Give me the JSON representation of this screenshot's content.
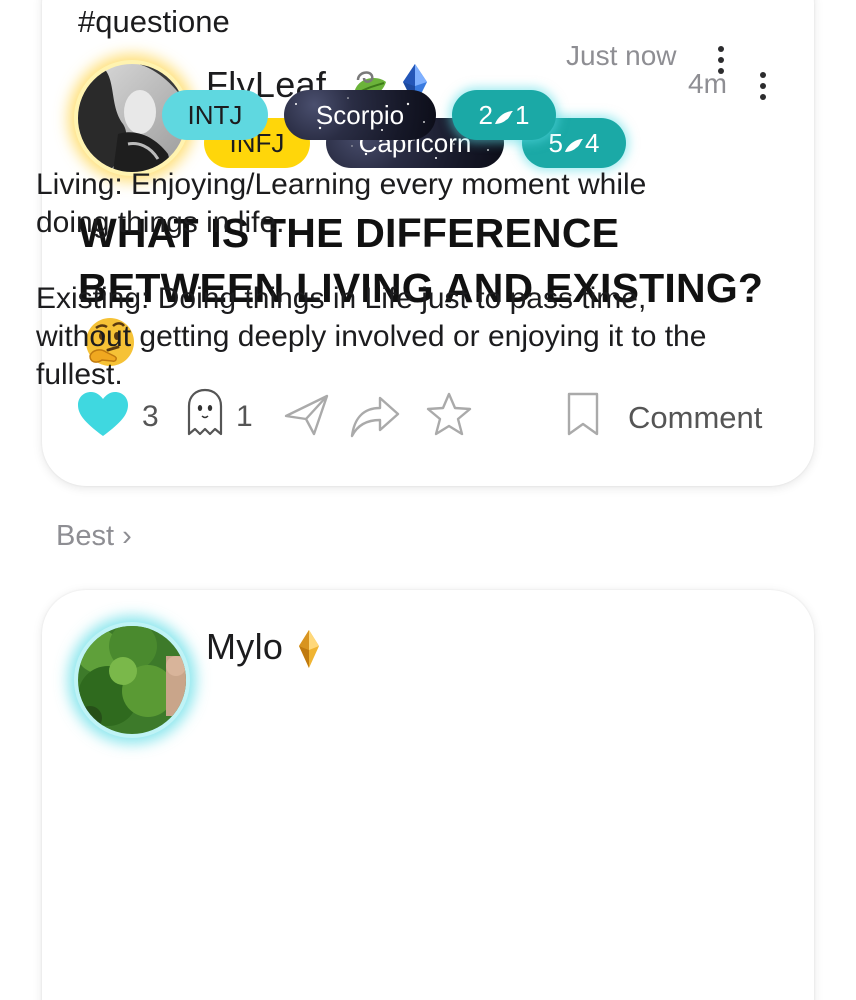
{
  "post": {
    "hashtag": "#questione",
    "author": {
      "name": "FlyLeaf",
      "badges": [
        "leaf-swirl-icon",
        "blue-crystal-icon"
      ],
      "mbti": "INFJ",
      "zodiac": "Capricorn",
      "enneagram_left": "5",
      "enneagram_right": "4"
    },
    "time": "4m",
    "title": "WHAT IS THE DIFFERENCE BETWEEN LIVING AND EXISTING?",
    "title_emoji": "thinking-face-emoji",
    "likes": "3",
    "ghost_count": "1",
    "comment_label": "Comment",
    "like_color": "#3fd8e0"
  },
  "sort": {
    "label": "Best",
    "chevron": "›"
  },
  "reply": {
    "author": {
      "name": "Mylo",
      "badges": [
        "gold-crystal-icon"
      ],
      "mbti": "INTJ",
      "zodiac": "Scorpio",
      "enneagram_left": "2",
      "enneagram_right": "1"
    },
    "time": "Just now",
    "body": "Living: Enjoying/Learning every moment while doing things in life.\n\nExisting: Doing things in Life just to pass time, without getting deeply involved or enjoying it to the fullest."
  },
  "colors": {
    "mbti_infj": "#ffd60a",
    "mbti_intj": "#5fd8e0",
    "enneagram": "#1ba9a6",
    "muted_text": "#8e8e93"
  }
}
